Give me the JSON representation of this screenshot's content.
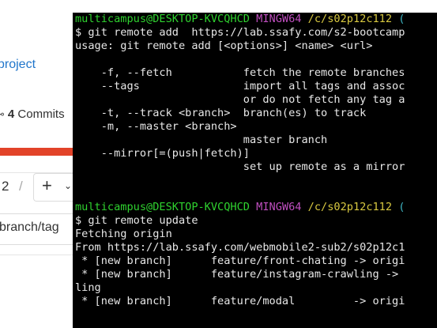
{
  "background_page": {
    "project_link": "project",
    "commits_count": "4",
    "commits_label": "Commits",
    "branch_counter": "2",
    "separator": "/",
    "add_button_symbol": "+",
    "add_button_chevron": "chevron-down-icon",
    "branch_tag_label": "branch/tag",
    "accent_color": "#e24329",
    "link_color": "#1f75cb"
  },
  "terminal": {
    "prompt_user": "multicampus@DESKTOP-KVCQHCD",
    "prompt_env": "MINGW64",
    "prompt_path": "/c/s02p12c112",
    "prompt_branch": "(",
    "lines": [
      {
        "kind": "prompt"
      },
      {
        "kind": "text",
        "text": "$ git remote add  https://lab.ssafy.com/s2-bootcamp"
      },
      {
        "kind": "text",
        "text": "usage: git remote add [<options>] <name> <url>"
      },
      {
        "kind": "text",
        "text": ""
      },
      {
        "kind": "text",
        "text": "    -f, --fetch           fetch the remote branches"
      },
      {
        "kind": "text",
        "text": "    --tags                import all tags and assoc"
      },
      {
        "kind": "text",
        "text": "                          or do not fetch any tag a"
      },
      {
        "kind": "text",
        "text": "    -t, --track <branch>  branch(es) to track"
      },
      {
        "kind": "text",
        "text": "    -m, --master <branch>"
      },
      {
        "kind": "text",
        "text": "                          master branch"
      },
      {
        "kind": "text",
        "text": "    --mirror[=(push|fetch)]"
      },
      {
        "kind": "text",
        "text": "                          set up remote as a mirror"
      },
      {
        "kind": "text",
        "text": ""
      },
      {
        "kind": "text",
        "text": ""
      },
      {
        "kind": "prompt"
      },
      {
        "kind": "text",
        "text": "$ git remote update"
      },
      {
        "kind": "text",
        "text": "Fetching origin"
      },
      {
        "kind": "text",
        "text": "From https://lab.ssafy.com/webmobile2-sub2/s02p12c1"
      },
      {
        "kind": "text",
        "text": " * [new branch]      feature/front-chating -> origi"
      },
      {
        "kind": "text",
        "text": " * [new branch]      feature/instagram-crawling ->"
      },
      {
        "kind": "text",
        "text": "ling"
      },
      {
        "kind": "text",
        "text": " * [new branch]      feature/modal         -> origi"
      },
      {
        "kind": "text",
        "text": ""
      },
      {
        "kind": "text",
        "text": ""
      }
    ],
    "colors": {
      "user": "#2fd22f",
      "env": "#c04fc0",
      "path": "#d8c840",
      "branch": "#3fb6c4",
      "text": "#e8e8e8",
      "background": "#000000"
    }
  }
}
